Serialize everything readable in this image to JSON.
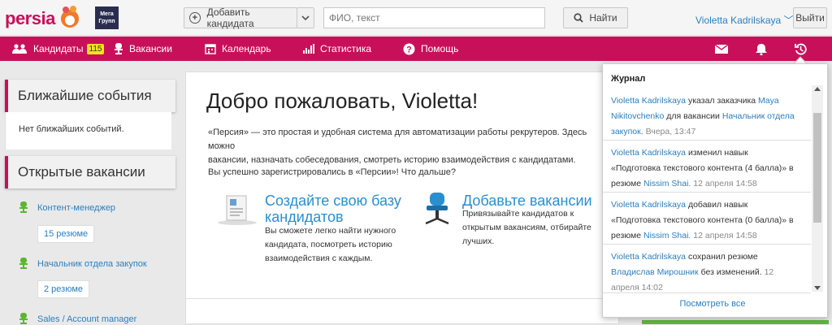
{
  "header": {
    "logo": "persia",
    "partner_logo": "Мега Групп",
    "add_candidate": "Добавить кандидата",
    "search_placeholder": "ФИО, текст",
    "find_button": "Найти",
    "user_name": "Violetta Kadrilskaya",
    "logout": "Выйти"
  },
  "nav": {
    "candidates": "Кандидаты",
    "candidates_count": "115",
    "vacancies": "Вакансии",
    "calendar": "Календарь",
    "statistics": "Статистика",
    "help": "Помощь"
  },
  "sidebar": {
    "events_title": "Ближайшие события",
    "no_events": "Нет ближайших событий.",
    "open_vacancies_title": "Открытые вакансии",
    "vacancies": [
      {
        "name": "Контент-менеджер",
        "resumes": "15 резюме"
      },
      {
        "name": "Начальник отдела закупок",
        "resumes": "2 резюме"
      },
      {
        "name": "Sales / Account manager",
        "resumes": ""
      }
    ]
  },
  "main": {
    "welcome": "Добро пожаловать, Violetta!",
    "intro_line1": "«Персия» — это простая и удобная система для автоматизации работы рекрутеров. Здесь можно",
    "intro_line2": "вакансии, назначать собеседования, смотреть историю взаимодействия с кандидатами.",
    "registered": "Вы успешно зарегистрировались в «Персии»! Что дальше?",
    "card1_title_line1": "Создайте свою базу",
    "card1_title_line2": "кандидатов",
    "card1_text1": "Вы сможете легко найти нужного",
    "card1_text2": "кандидата, посмотреть историю",
    "card1_text3": "взаимодействия с каждым.",
    "card2_title": "Добавьте вакансии",
    "card2_text1": "Привязывайте кандидатов к",
    "card2_text2": "открытым вакансиям, отбирайте",
    "card2_text3": "лучших."
  },
  "journal": {
    "title": "Журнал",
    "see_all": "Посмотреть все",
    "entries": [
      {
        "user": "Violetta Kadrilskaya",
        "a1": "указал заказчика",
        "l1": "Maya",
        "l1b": "Nikitovchenko",
        "a2": "для вакансии",
        "l2": "Начальник отдела",
        "l2b": "закупок.",
        "time": "Вчера, 13:47"
      },
      {
        "user": "Violetta Kadrilskaya",
        "a1": "изменил навык",
        "a1b": "«Подготовка текстового контента (4 балла)» в",
        "a2": "резюме",
        "l2": "Nissim Shai.",
        "time": "12 апреля 14:58"
      },
      {
        "user": "Violetta Kadrilskaya",
        "a1": "добавил навык",
        "a1b": "«Подготовка текстового контента (0 балла)» в",
        "a2": "резюме",
        "l2": "Nissim Shai.",
        "time": "12 апреля 14:58"
      },
      {
        "user": "Violetta Kadrilskaya",
        "a1": "сохранил резюме",
        "l2": "Владислав Мирошник",
        "a2": "без изменений.",
        "time_a": "12",
        "time_b": "апреля 14:02"
      }
    ]
  }
}
